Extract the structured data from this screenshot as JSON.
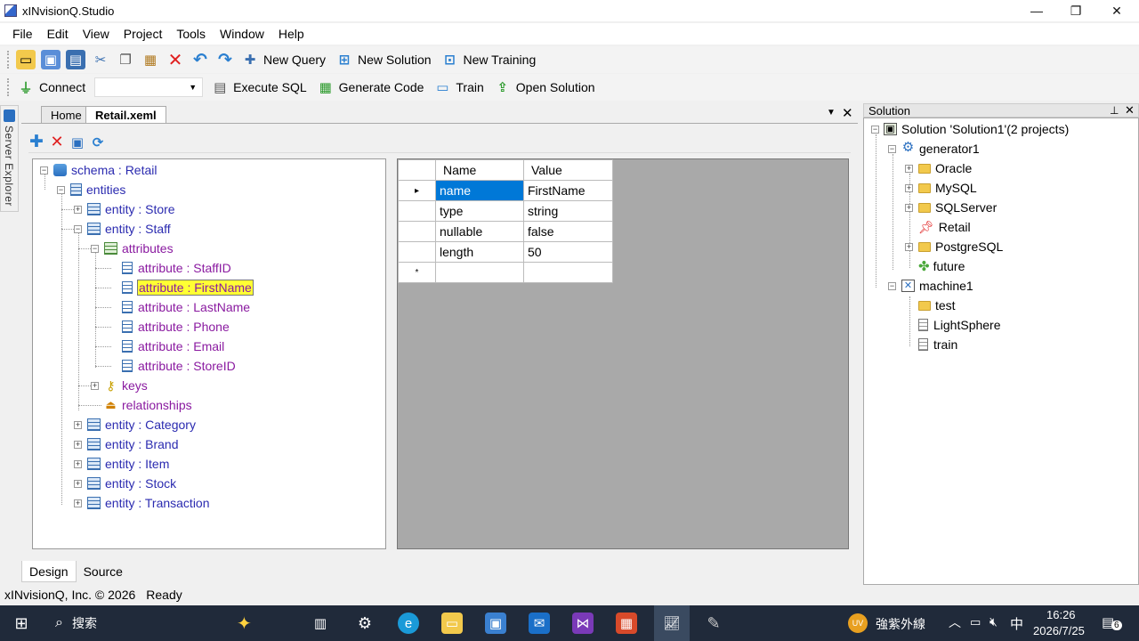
{
  "window": {
    "title": "xINvisionQ.Studio"
  },
  "menu": [
    "File",
    "Edit",
    "View",
    "Project",
    "Tools",
    "Window",
    "Help"
  ],
  "toolbar1": {
    "new_query": "New Query",
    "new_solution": "New Solution",
    "new_training": "New Training"
  },
  "toolbar2": {
    "connect": "Connect",
    "connection_value": "",
    "execute_sql": "Execute SQL",
    "generate_code": "Generate Code",
    "train": "Train",
    "open_solution": "Open Solution"
  },
  "server_explorer": "Server Explorer",
  "doc_tabs": [
    "Home",
    "Retail.xeml"
  ],
  "tree": {
    "schema": "schema : Retail",
    "entities": "entities",
    "store": "entity : Store",
    "staff": "entity : Staff",
    "attributes": "attributes",
    "attrs": [
      "attribute : StaffID",
      "attribute : FirstName",
      "attribute : LastName",
      "attribute : Phone",
      "attribute : Email",
      "attribute : StoreID"
    ],
    "keys": "keys",
    "relationships": "relationships",
    "more_entities": [
      "entity : Category",
      "entity : Brand",
      "entity : Item",
      "entity : Stock",
      "entity : Transaction"
    ]
  },
  "grid": {
    "headers": [
      "Name",
      "Value"
    ],
    "rows": [
      [
        "name",
        "FirstName"
      ],
      [
        "type",
        "string"
      ],
      [
        "nullable",
        "false"
      ],
      [
        "length",
        "50"
      ]
    ],
    "new_row_marker": "*",
    "current_row_marker": "▸"
  },
  "bottom_tabs": [
    "Design",
    "Source"
  ],
  "solution": {
    "header": "Solution",
    "root": "Solution 'Solution1'(2 projects)",
    "generator": "generator1",
    "gen_items": [
      "Oracle",
      "MySQL",
      "SQLServer",
      "Retail",
      "PostgreSQL",
      "future"
    ],
    "machine": "machine1",
    "machine_items": [
      "test",
      "LightSphere",
      "train"
    ]
  },
  "status": {
    "copyright": "xINvisionQ, Inc. © 2026",
    "state": "Ready"
  },
  "taskbar": {
    "search": "搜索",
    "weather": "強紫外線",
    "ime": "中",
    "time": "16:26",
    "date": "2026/7/25",
    "notifications": "6"
  }
}
